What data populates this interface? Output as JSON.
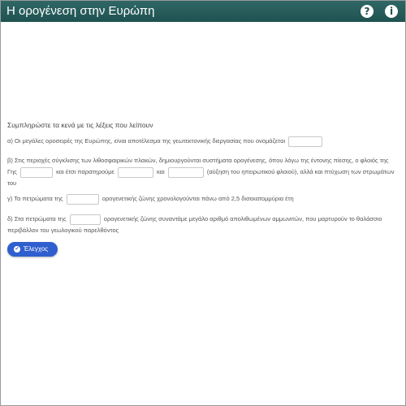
{
  "app": {
    "title": "Η ορογένεση στην Ευρώπη",
    "help_icon": "?",
    "info_icon": "i"
  },
  "instructions": "Συμπληρώστε τα κενά με τις λέξεις που λείπουν",
  "questions": {
    "q1": {
      "text_before": "α) Οι μεγάλες οροσειρές της Ευρώπης, είναι αποτέλεσμα της γεωτεκτονικής διεργασίας που ονομάζεται"
    },
    "q2": {
      "text_1": "β) Στις περιοχές σύγκλισης των λιθοσφαιρικών πλακών, δημιουργούνται συστήματα ορογένεσης, όπου λόγω της έντονης πίεσης, ο φλοιός της Γης",
      "text_2": "και έτσι παρατηρούμε",
      "text_3": "και",
      "text_4": "(αύξηση του ηπειρωτικού φλοιού), αλλά και πτύχωση των στρωμάτων του"
    },
    "q3": {
      "text_before": "γ) Τα πετρώματα της",
      "text_after": "ορογενετικής ζώνης χρονολογούνται πάνω από 2,5 δισεκατομμύρια έτη"
    },
    "q4": {
      "text_before": "δ) Στα πετρώματα της",
      "text_after": "ορογενετικής ζώνης συναντάμε μεγάλο αριθμό απολιθωμένων αμμωνιτών, που μαρτυρούν το θαλάσσιο περιβάλλον του γεωλογικού παρελθόντος"
    }
  },
  "check_button": {
    "label": "Έλεγχος",
    "icon": "✔"
  }
}
